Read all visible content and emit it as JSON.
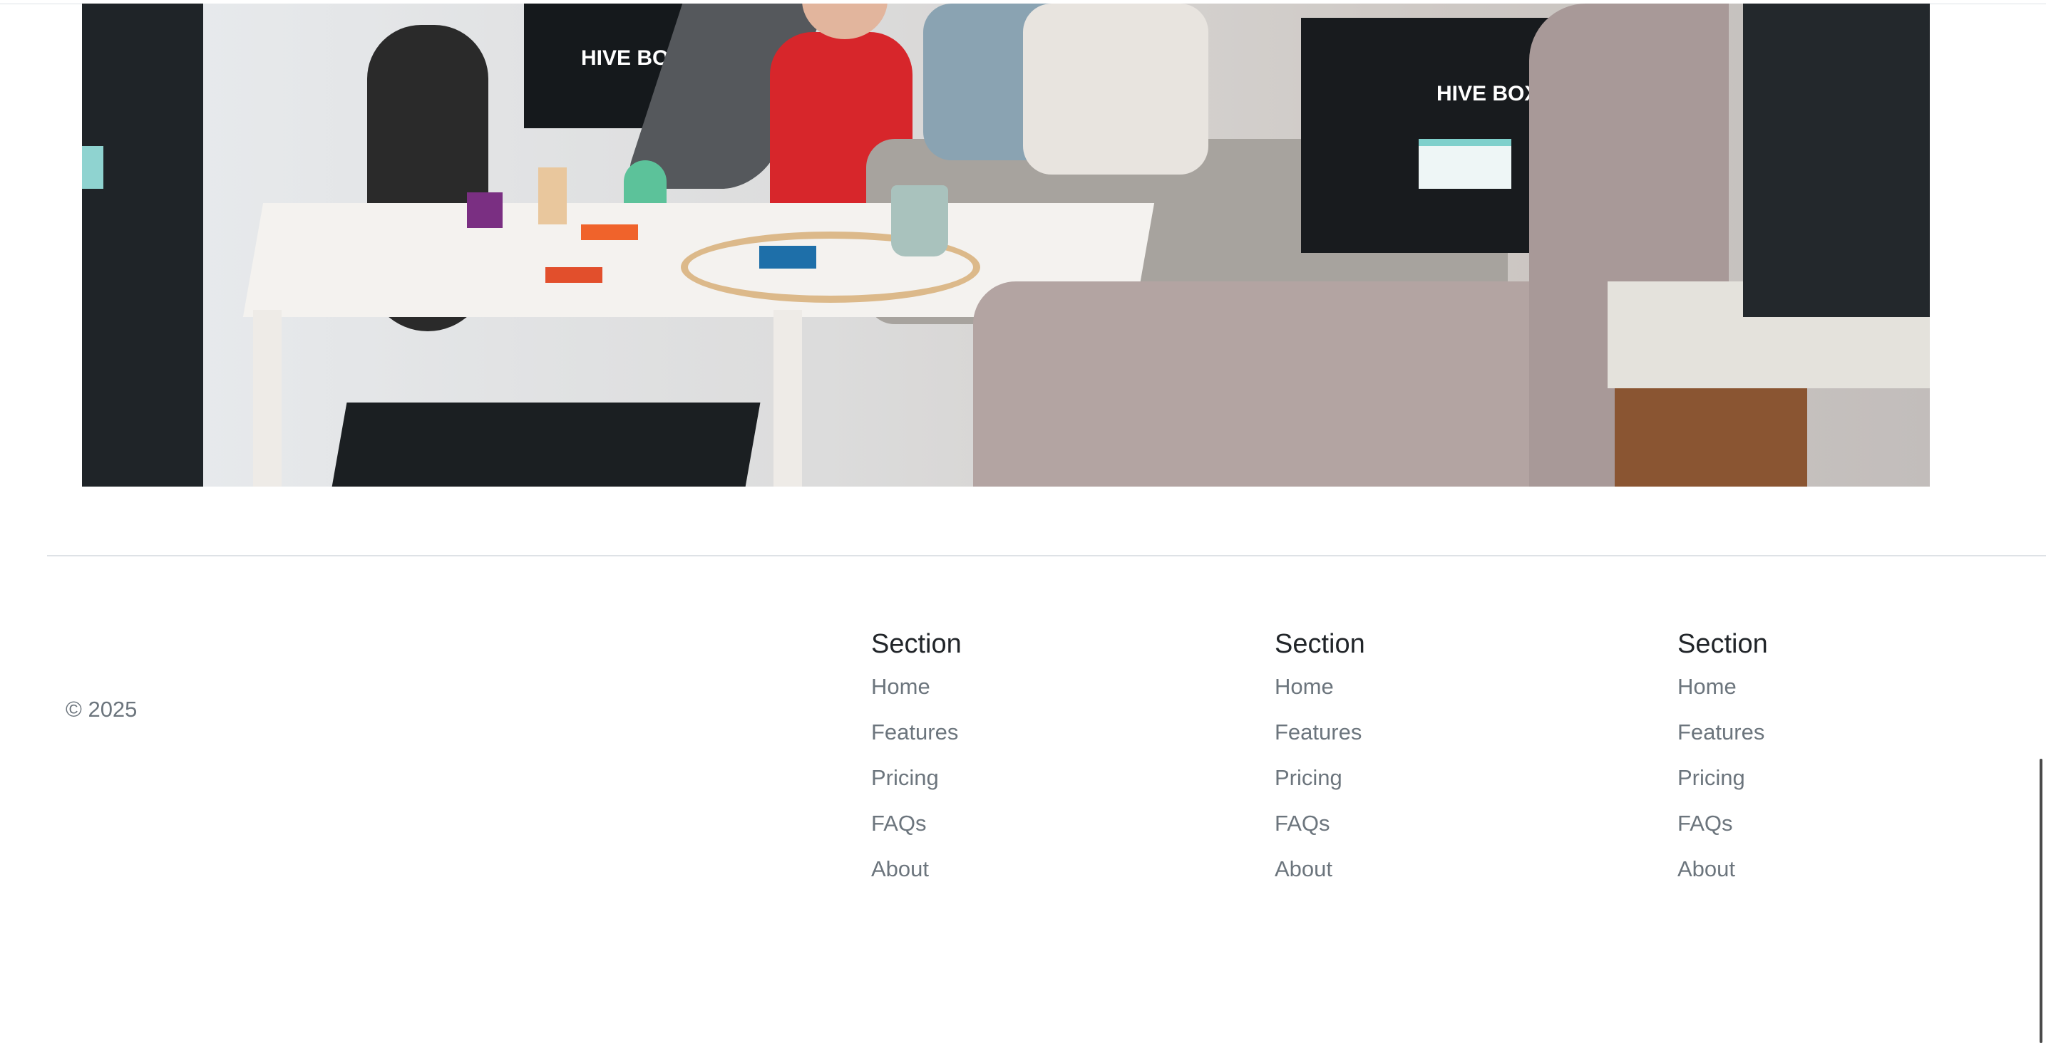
{
  "footer": {
    "copyright": "© 2025",
    "columns": [
      {
        "heading": "Section",
        "links": [
          "Home",
          "Features",
          "Pricing",
          "FAQs",
          "About"
        ]
      },
      {
        "heading": "Section",
        "links": [
          "Home",
          "Features",
          "Pricing",
          "FAQs",
          "About"
        ]
      },
      {
        "heading": "Section",
        "links": [
          "Home",
          "Features",
          "Pricing",
          "FAQs",
          "About"
        ]
      }
    ]
  },
  "hero_image": {
    "box_label": "HIVE BOXX"
  },
  "colors": {
    "divider": "#dee2e6",
    "heading": "#212529",
    "link": "#6c757d"
  }
}
